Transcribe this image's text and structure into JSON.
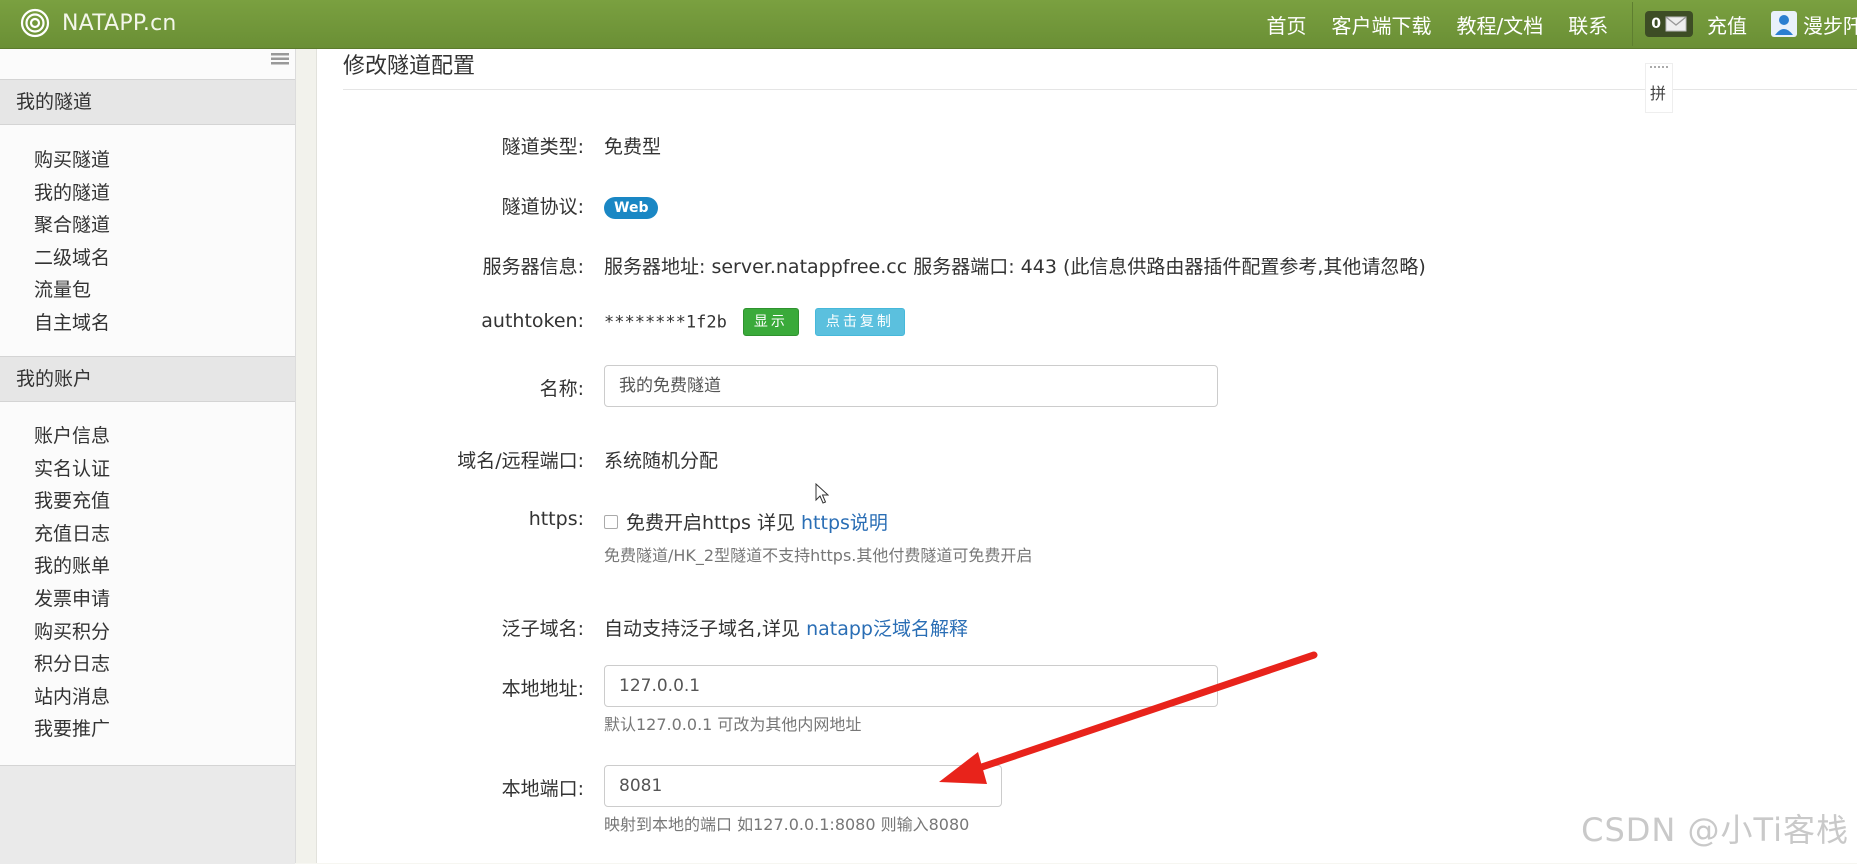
{
  "navbar": {
    "brand": "NATAPP.cn",
    "links": [
      "首页",
      "客户端下载",
      "教程/文档",
      "联系"
    ],
    "message_count": "0",
    "recharge": "充值",
    "user": "漫步阡陌"
  },
  "sidebar": {
    "section1": {
      "title": "我的隧道",
      "items": [
        "购买隧道",
        "我的隧道",
        "聚合隧道",
        "二级域名",
        "流量包",
        "自主域名"
      ]
    },
    "section2": {
      "title": "我的账户",
      "items": [
        "账户信息",
        "实名认证",
        "我要充值",
        "充值日志",
        "我的账单",
        "发票申请",
        "购买积分",
        "积分日志",
        "站内消息",
        "我要推广"
      ]
    }
  },
  "main": {
    "title": "修改隧道配置",
    "ime_glyph": "拼",
    "fields": {
      "type_label": "隧道类型:",
      "type_value": "免费型",
      "protocol_label": "隧道协议:",
      "protocol_value": "Web",
      "server_label": "服务器信息:",
      "server_value": "服务器地址: server.natappfree.cc 服务器端口: 443 (此信息供路由器插件配置参考,其他请忽略)",
      "authtoken_label": "authtoken:",
      "authtoken_value": "********1f2b",
      "show_button": "显示",
      "copy_button": "点击复制",
      "name_label": "名称:",
      "name_value": "我的免费隧道",
      "domain_label": "域名/远程端口:",
      "domain_value": "系统随机分配",
      "https_label": "https:",
      "https_text": "免费开启https 详见",
      "https_link": "https说明",
      "https_help": "免费隧道/HK_2型隧道不支持https.其他付费隧道可免费开启",
      "wildcard_label": "泛子域名:",
      "wildcard_text": "自动支持泛子域名,详见",
      "wildcard_link": "natapp泛域名解释",
      "local_addr_label": "本地地址:",
      "local_addr_value": "127.0.0.1",
      "local_addr_help": "默认127.0.0.1 可改为其他内网地址",
      "local_port_label": "本地端口:",
      "local_port_value": "8081",
      "local_port_help": "映射到本地的端口 如127.0.0.1:8080 则输入8080"
    }
  },
  "annotation_color": "#e8231b",
  "watermark": "CSDN @小Ti客栈"
}
